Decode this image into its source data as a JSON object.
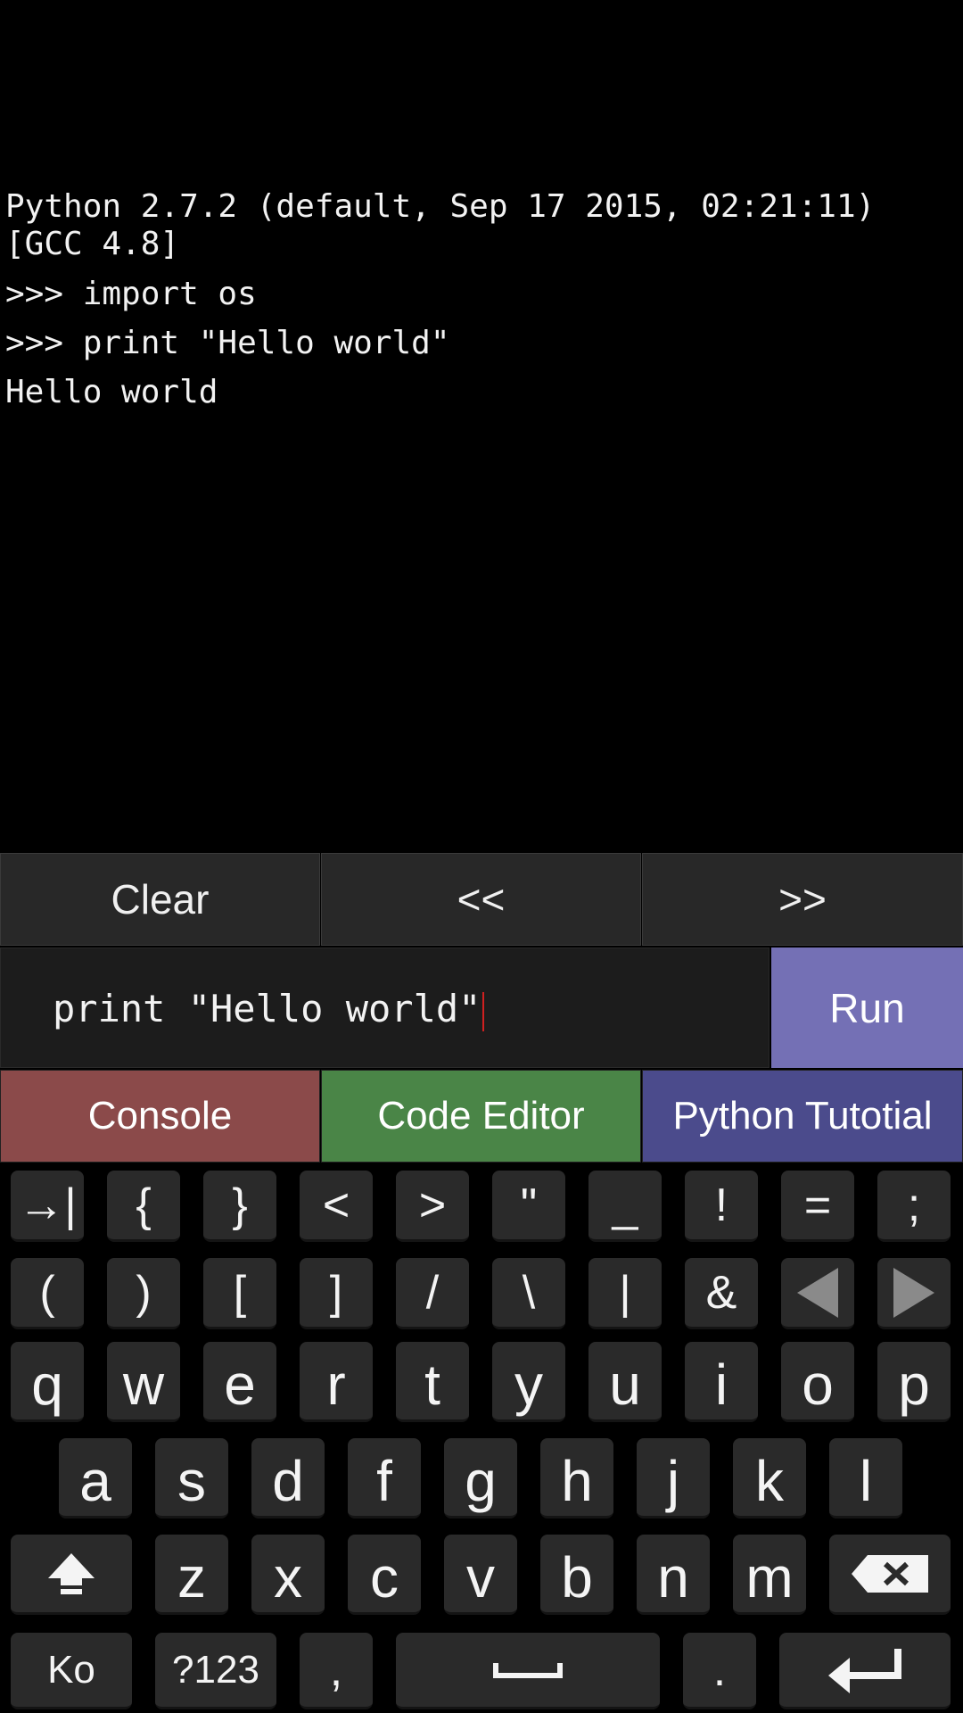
{
  "console": {
    "lines": [
      "Python 2.7.2 (default, Sep 17 2015, 02:21:11)",
      "[GCC 4.8]",
      ">>> import os",
      ">>> print \"Hello world\"",
      "Hello world"
    ]
  },
  "toolbar": {
    "clear_label": "Clear",
    "prev_label": "<<",
    "next_label": ">>"
  },
  "input": {
    "value": "print \"Hello world\"",
    "run_label": "Run"
  },
  "tabs": [
    {
      "label": "Console",
      "color": "#8b4a4a"
    },
    {
      "label": "Code Editor",
      "color": "#4a8547"
    },
    {
      "label": "Python Tutotial",
      "color": "#4b4b8c"
    }
  ],
  "keyboard": {
    "row1": [
      "→|",
      "{",
      "}",
      "<",
      ">",
      "\"",
      "_",
      "!",
      "=",
      ";"
    ],
    "row2": [
      "(",
      ")",
      "[",
      "]",
      "/",
      "\\",
      "|",
      "&"
    ],
    "row3": [
      "q",
      "w",
      "e",
      "r",
      "t",
      "y",
      "u",
      "i",
      "o",
      "p"
    ],
    "row4": [
      "a",
      "s",
      "d",
      "f",
      "g",
      "h",
      "j",
      "k",
      "l"
    ],
    "row5": [
      "z",
      "x",
      "c",
      "v",
      "b",
      "n",
      "m"
    ],
    "lang_label": "Ko",
    "symbols_label": "?123",
    "comma_label": ",",
    "period_label": "."
  }
}
